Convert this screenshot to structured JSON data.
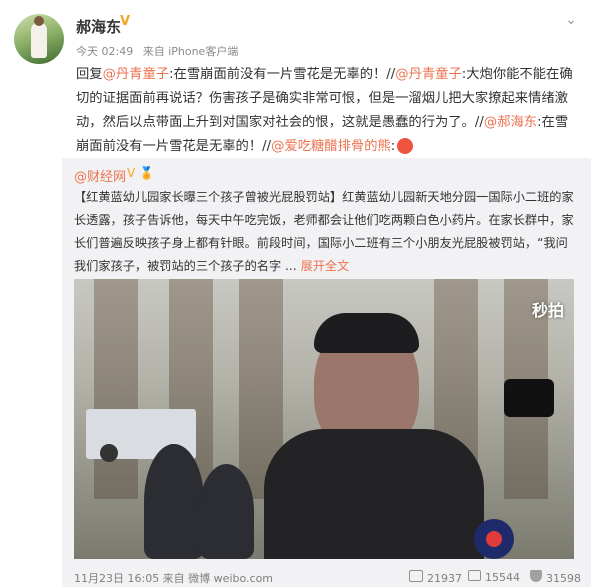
{
  "post": {
    "author": "郝海东",
    "verified_badge": "V",
    "timestamp": "今天 02:49",
    "source": "来自 iPhone客户端",
    "text_parts": {
      "p1": "回复",
      "p2": "@丹青童子",
      "p3": ":在雪崩面前没有一片雪花是无辜的！//",
      "p4": "@丹青童子",
      "p5": ":大炮你能不能在确切的证据面前再说话？伤害孩子是确实非常可恨，但是一溜烟儿把大家撩起来情绪激动，然后以点带面上升到对国家对社会的恨，这就是愚蠢的行为了。//",
      "p6": "@郝海东",
      "p7": ":在雪崩面前没有一片雪花是无辜的！//",
      "p8": "@爱吃糖醋排骨的熊",
      "p9": ":"
    }
  },
  "repost": {
    "author": "@财经网",
    "badges": "V 🏅",
    "text": "【红黄蓝幼儿园家长曝三个孩子曾被光屁股罚站】红黄蓝幼儿园新天地分园一国际小二班的家长透露，孩子告诉他，每天中午吃完饭，老师都会让他们吃两颗白色小药片。在家长群中，家长们普遍反映孩子身上都有针眼。前段时间，国际小二班有三个小朋友光屁股被罚站，“我问我们家孩子，被罚站的三个孩子的名字 ...",
    "expand_label": "展开全文",
    "watermark": "秒拍",
    "footer": {
      "date": "11月23日 16:05 来自 微博 weibo.com",
      "share_count": "21937",
      "comment_count": "15544",
      "like_count": "31598"
    }
  },
  "icons": {
    "more": "chevron-down-icon",
    "share": "share-icon",
    "comment": "comment-icon",
    "like": "like-icon",
    "play_watermark": "miaopai-icon"
  },
  "colors": {
    "link": "#eb7350",
    "badge": "#f5a623",
    "repost_bg": "#f2f2f5"
  }
}
